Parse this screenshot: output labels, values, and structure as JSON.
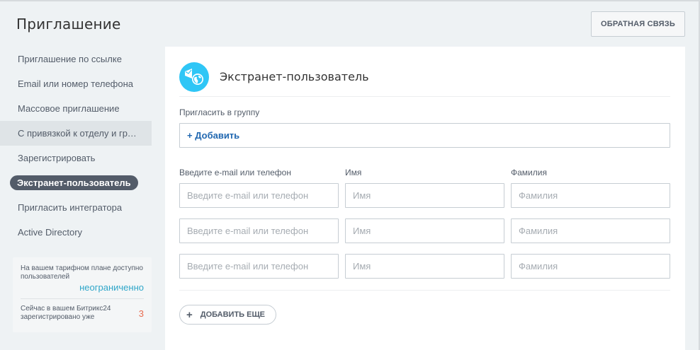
{
  "page": {
    "title": "Приглашение"
  },
  "toolbar": {
    "feedback_label": "Обратная связь"
  },
  "menu": {
    "items": [
      {
        "label": "Приглашение по ссылке"
      },
      {
        "label": "Email или номер телефона"
      },
      {
        "label": "Массовое приглашение"
      },
      {
        "label": "С привязкой к отделу и группе"
      },
      {
        "label": "Зарегистрировать"
      },
      {
        "label": "Экстранет-пользователь"
      },
      {
        "label": "Пригласить интегратора"
      },
      {
        "label": "Active Directory"
      }
    ],
    "active_index": 5
  },
  "info": {
    "plan_text": "На вашем тарифном плане доступно пользователей",
    "plan_value": "неограниченно",
    "registered_text": "Сейчас в вашем Битрикс24 зарегистрировано уже",
    "registered_value": "3"
  },
  "panel": {
    "title": "Экстранет-пользователь",
    "icon": "extranet-globe-icon",
    "group_label": "Пригласить в группу",
    "group_add": "+ Добавить",
    "columns": {
      "contact": "Введите e-mail или телефон",
      "name": "Имя",
      "surname": "Фамилия"
    },
    "rows": [
      {
        "contact_placeholder": "Введите e-mail или телефон",
        "name_placeholder": "Имя",
        "surname_placeholder": "Фамилия"
      },
      {
        "contact_placeholder": "Введите e-mail или телефон",
        "name_placeholder": "Имя",
        "surname_placeholder": "Фамилия"
      },
      {
        "contact_placeholder": "Введите e-mail или телефон",
        "name_placeholder": "Имя",
        "surname_placeholder": "Фамилия"
      }
    ],
    "add_more_label": "Добавить еще"
  },
  "colors": {
    "accent": "#2fc6f6",
    "link": "#2067b0",
    "count": "#e86c50",
    "plan": "#2fa6c9"
  }
}
